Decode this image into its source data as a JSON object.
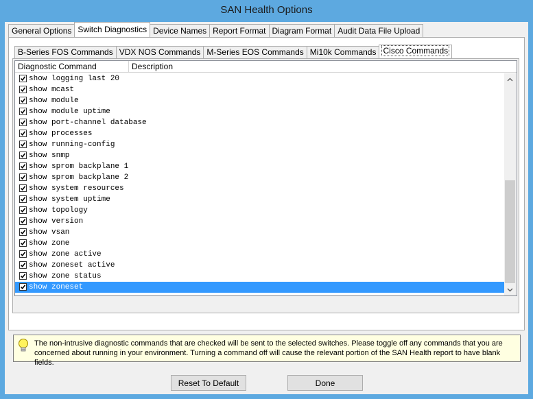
{
  "window": {
    "title": "SAN Health Options"
  },
  "tabs": [
    "General Options",
    "Switch Diagnostics",
    "Device Names",
    "Report Format",
    "Diagram Format",
    "Audit Data File Upload"
  ],
  "subtabs": [
    "B-Series FOS Commands",
    "VDX NOS Commands",
    "M-Series EOS Commands",
    "Mi10k Commands",
    "Cisco Commands"
  ],
  "columns": {
    "command": "Diagnostic Command",
    "description": "Description"
  },
  "commands": [
    "show logging last 20",
    "show mcast",
    "show module",
    "show module uptime",
    "show port-channel database",
    "show processes",
    "show running-config",
    "show snmp",
    "show sprom backplane 1",
    "show sprom backplane 2",
    "show system resources",
    "show system uptime",
    "show topology",
    "show version",
    "show vsan",
    "show zone",
    "show zone active",
    "show zoneset active",
    "show zone status",
    "show zoneset"
  ],
  "info": {
    "text": "The non-intrusive diagnostic commands that are checked will be sent to the selected switches.  Please toggle off any commands that you are concerned about running in your environment.  Turning a command off will cause the relevant portion of the SAN Health report to have blank fields."
  },
  "buttons": {
    "reset": "Reset To Default",
    "done": "Done"
  }
}
